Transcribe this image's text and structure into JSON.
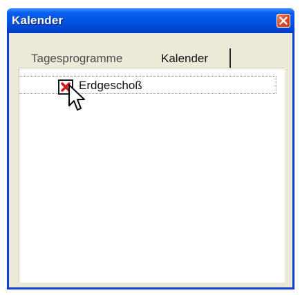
{
  "window": {
    "title": "Kalender"
  },
  "tabs": [
    {
      "label": "Tagesprogramme"
    },
    {
      "label": "Kalender"
    }
  ],
  "tree": {
    "items": [
      {
        "label": "Erdgeschoß",
        "icon": "red-x-icon"
      }
    ]
  },
  "colors": {
    "titlebar": "#0154e3",
    "close_button": "#e04f2c",
    "window_bg": "#ece9d8",
    "x_icon": "#d01818"
  },
  "icons": {
    "close": "close-icon",
    "item": "red-x-icon",
    "cursor": "mouse-pointer-icon"
  }
}
